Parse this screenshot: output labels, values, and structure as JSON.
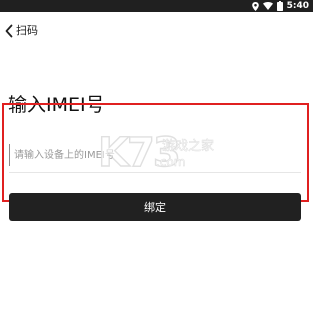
{
  "status_bar": {
    "time": "5:40",
    "icons": [
      "location-icon",
      "wifi-icon",
      "battery-icon"
    ]
  },
  "nav": {
    "back_icon": "chevron-left-icon",
    "title": "扫码"
  },
  "page": {
    "title": "输入IMEI号"
  },
  "imei_input": {
    "value": "",
    "placeholder": "请输入设备上的IMEI号"
  },
  "bind_button": {
    "label": "绑定"
  },
  "watermark": {
    "brand": "K73",
    "cn": "游戏之家",
    "domain": ".com"
  },
  "colors": {
    "status_bar": "#202020",
    "highlight_border": "#e02020",
    "button_bg": "#212121",
    "button_text": "#ffffff"
  }
}
